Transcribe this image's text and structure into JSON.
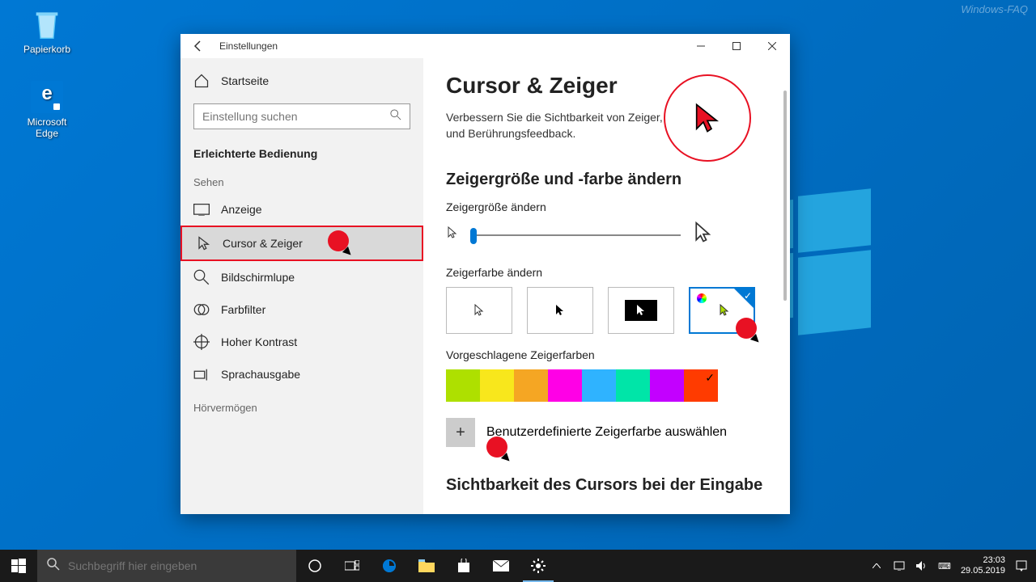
{
  "watermark": "Windows-FAQ",
  "desktop_icons": {
    "recycle_bin": "Papierkorb",
    "edge": "Microsoft Edge"
  },
  "window": {
    "title": "Einstellungen"
  },
  "sidebar": {
    "home": "Startseite",
    "search_placeholder": "Einstellung suchen",
    "section": "Erleichterte Bedienung",
    "sehen": "Sehen",
    "items": {
      "anzeige": "Anzeige",
      "cursor": "Cursor & Zeiger",
      "lupe": "Bildschirmlupe",
      "farbfilter": "Farbfilter",
      "kontrast": "Hoher Kontrast",
      "sprachausgabe": "Sprachausgabe"
    },
    "hoervermoegen": "Hörvermögen"
  },
  "content": {
    "title": "Cursor & Zeiger",
    "desc": "Verbessern Sie die Sichtbarkeit von Zeiger, Cursor und Berührungsfeedback.",
    "section1": "Zeigergröße und -farbe ändern",
    "size_label": "Zeigergröße ändern",
    "color_label": "Zeigerfarbe ändern",
    "suggested_label": "Vorgeschlagene Zeigerfarben",
    "custom_label": "Benutzerdefinierte Zeigerfarbe auswählen",
    "section2": "Sichtbarkeit des Cursors bei der Eingabe"
  },
  "colors": {
    "suggested": [
      "#aee000",
      "#f8e71c",
      "#f5a623",
      "#ff00e6",
      "#2fb3ff",
      "#00e5a8",
      "#c300ff",
      "#ff3b00"
    ],
    "selected_index": 7
  },
  "taskbar": {
    "search_placeholder": "Suchbegriff hier eingeben",
    "time": "23:03",
    "date": "29.05.2019"
  }
}
